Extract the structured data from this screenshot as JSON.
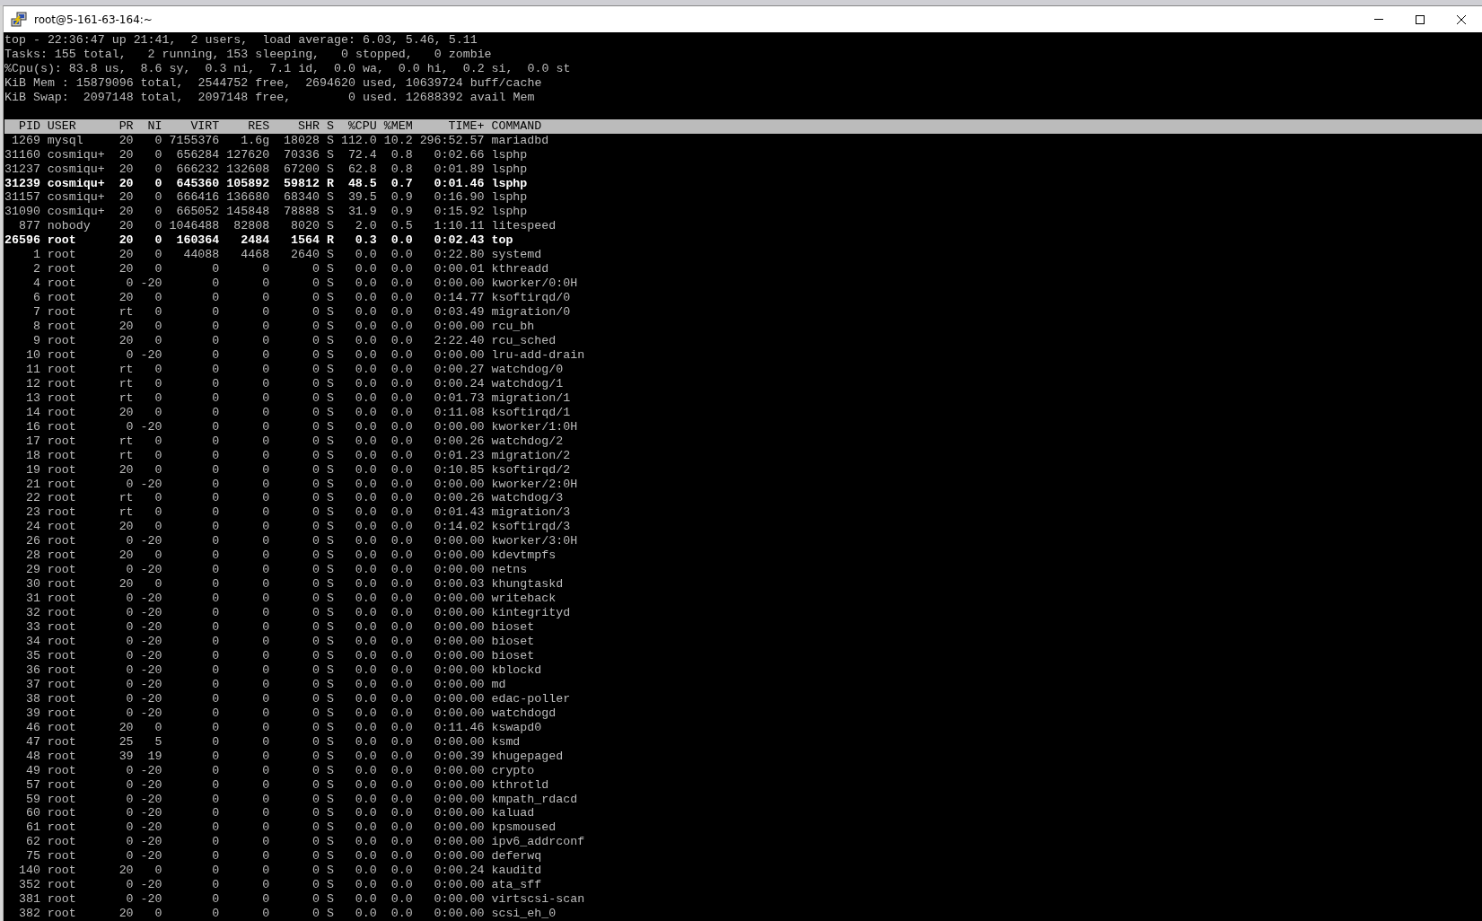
{
  "window": {
    "title": "root@5-161-63-164:~"
  },
  "summary": [
    "top - 22:36:47 up 21:41,  2 users,  load average: 6.03, 5.46, 5.11",
    "Tasks: 155 total,   2 running, 153 sleeping,   0 stopped,   0 zombie",
    "%Cpu(s): 83.8 us,  8.6 sy,  0.3 ni,  7.1 id,  0.0 wa,  0.0 hi,  0.2 si,  0.0 st",
    "KiB Mem : 15879096 total,  2544752 free,  2694620 used, 10639724 buff/cache",
    "KiB Swap:  2097148 total,  2097148 free,        0 used. 12688392 avail Mem"
  ],
  "table": {
    "columns": [
      "PID",
      "USER",
      "PR",
      "NI",
      "VIRT",
      "RES",
      "SHR",
      "S",
      "%CPU",
      "%MEM",
      "TIME+",
      "COMMAND"
    ],
    "rows": [
      {
        "bold": false,
        "cells": [
          "1269",
          "mysql",
          "20",
          "0",
          "7155376",
          "1.6g",
          "18028",
          "S",
          "112.0",
          "10.2",
          "296:52.57",
          "mariadbd"
        ]
      },
      {
        "bold": false,
        "cells": [
          "31160",
          "cosmiqu+",
          "20",
          "0",
          "656284",
          "127620",
          "70336",
          "S",
          "72.4",
          "0.8",
          "0:02.66",
          "lsphp"
        ]
      },
      {
        "bold": false,
        "cells": [
          "31237",
          "cosmiqu+",
          "20",
          "0",
          "666232",
          "132608",
          "67200",
          "S",
          "62.8",
          "0.8",
          "0:01.89",
          "lsphp"
        ]
      },
      {
        "bold": true,
        "cells": [
          "31239",
          "cosmiqu+",
          "20",
          "0",
          "645360",
          "105892",
          "59812",
          "R",
          "48.5",
          "0.7",
          "0:01.46",
          "lsphp"
        ]
      },
      {
        "bold": false,
        "cells": [
          "31157",
          "cosmiqu+",
          "20",
          "0",
          "666416",
          "136680",
          "68340",
          "S",
          "39.5",
          "0.9",
          "0:16.90",
          "lsphp"
        ]
      },
      {
        "bold": false,
        "cells": [
          "31090",
          "cosmiqu+",
          "20",
          "0",
          "665052",
          "145848",
          "78888",
          "S",
          "31.9",
          "0.9",
          "0:15.92",
          "lsphp"
        ]
      },
      {
        "bold": false,
        "cells": [
          "877",
          "nobody",
          "20",
          "0",
          "1046488",
          "82808",
          "8020",
          "S",
          "2.0",
          "0.5",
          "1:10.11",
          "litespeed"
        ]
      },
      {
        "bold": true,
        "cells": [
          "26596",
          "root",
          "20",
          "0",
          "160364",
          "2484",
          "1564",
          "R",
          "0.3",
          "0.0",
          "0:02.43",
          "top"
        ]
      },
      {
        "bold": false,
        "cells": [
          "1",
          "root",
          "20",
          "0",
          "44088",
          "4468",
          "2640",
          "S",
          "0.0",
          "0.0",
          "0:22.80",
          "systemd"
        ]
      },
      {
        "bold": false,
        "cells": [
          "2",
          "root",
          "20",
          "0",
          "0",
          "0",
          "0",
          "S",
          "0.0",
          "0.0",
          "0:00.01",
          "kthreadd"
        ]
      },
      {
        "bold": false,
        "cells": [
          "4",
          "root",
          "0",
          "-20",
          "0",
          "0",
          "0",
          "S",
          "0.0",
          "0.0",
          "0:00.00",
          "kworker/0:0H"
        ]
      },
      {
        "bold": false,
        "cells": [
          "6",
          "root",
          "20",
          "0",
          "0",
          "0",
          "0",
          "S",
          "0.0",
          "0.0",
          "0:14.77",
          "ksoftirqd/0"
        ]
      },
      {
        "bold": false,
        "cells": [
          "7",
          "root",
          "rt",
          "0",
          "0",
          "0",
          "0",
          "S",
          "0.0",
          "0.0",
          "0:03.49",
          "migration/0"
        ]
      },
      {
        "bold": false,
        "cells": [
          "8",
          "root",
          "20",
          "0",
          "0",
          "0",
          "0",
          "S",
          "0.0",
          "0.0",
          "0:00.00",
          "rcu_bh"
        ]
      },
      {
        "bold": false,
        "cells": [
          "9",
          "root",
          "20",
          "0",
          "0",
          "0",
          "0",
          "S",
          "0.0",
          "0.0",
          "2:22.40",
          "rcu_sched"
        ]
      },
      {
        "bold": false,
        "cells": [
          "10",
          "root",
          "0",
          "-20",
          "0",
          "0",
          "0",
          "S",
          "0.0",
          "0.0",
          "0:00.00",
          "lru-add-drain"
        ]
      },
      {
        "bold": false,
        "cells": [
          "11",
          "root",
          "rt",
          "0",
          "0",
          "0",
          "0",
          "S",
          "0.0",
          "0.0",
          "0:00.27",
          "watchdog/0"
        ]
      },
      {
        "bold": false,
        "cells": [
          "12",
          "root",
          "rt",
          "0",
          "0",
          "0",
          "0",
          "S",
          "0.0",
          "0.0",
          "0:00.24",
          "watchdog/1"
        ]
      },
      {
        "bold": false,
        "cells": [
          "13",
          "root",
          "rt",
          "0",
          "0",
          "0",
          "0",
          "S",
          "0.0",
          "0.0",
          "0:01.73",
          "migration/1"
        ]
      },
      {
        "bold": false,
        "cells": [
          "14",
          "root",
          "20",
          "0",
          "0",
          "0",
          "0",
          "S",
          "0.0",
          "0.0",
          "0:11.08",
          "ksoftirqd/1"
        ]
      },
      {
        "bold": false,
        "cells": [
          "16",
          "root",
          "0",
          "-20",
          "0",
          "0",
          "0",
          "S",
          "0.0",
          "0.0",
          "0:00.00",
          "kworker/1:0H"
        ]
      },
      {
        "bold": false,
        "cells": [
          "17",
          "root",
          "rt",
          "0",
          "0",
          "0",
          "0",
          "S",
          "0.0",
          "0.0",
          "0:00.26",
          "watchdog/2"
        ]
      },
      {
        "bold": false,
        "cells": [
          "18",
          "root",
          "rt",
          "0",
          "0",
          "0",
          "0",
          "S",
          "0.0",
          "0.0",
          "0:01.23",
          "migration/2"
        ]
      },
      {
        "bold": false,
        "cells": [
          "19",
          "root",
          "20",
          "0",
          "0",
          "0",
          "0",
          "S",
          "0.0",
          "0.0",
          "0:10.85",
          "ksoftirqd/2"
        ]
      },
      {
        "bold": false,
        "cells": [
          "21",
          "root",
          "0",
          "-20",
          "0",
          "0",
          "0",
          "S",
          "0.0",
          "0.0",
          "0:00.00",
          "kworker/2:0H"
        ]
      },
      {
        "bold": false,
        "cells": [
          "22",
          "root",
          "rt",
          "0",
          "0",
          "0",
          "0",
          "S",
          "0.0",
          "0.0",
          "0:00.26",
          "watchdog/3"
        ]
      },
      {
        "bold": false,
        "cells": [
          "23",
          "root",
          "rt",
          "0",
          "0",
          "0",
          "0",
          "S",
          "0.0",
          "0.0",
          "0:01.43",
          "migration/3"
        ]
      },
      {
        "bold": false,
        "cells": [
          "24",
          "root",
          "20",
          "0",
          "0",
          "0",
          "0",
          "S",
          "0.0",
          "0.0",
          "0:14.02",
          "ksoftirqd/3"
        ]
      },
      {
        "bold": false,
        "cells": [
          "26",
          "root",
          "0",
          "-20",
          "0",
          "0",
          "0",
          "S",
          "0.0",
          "0.0",
          "0:00.00",
          "kworker/3:0H"
        ]
      },
      {
        "bold": false,
        "cells": [
          "28",
          "root",
          "20",
          "0",
          "0",
          "0",
          "0",
          "S",
          "0.0",
          "0.0",
          "0:00.00",
          "kdevtmpfs"
        ]
      },
      {
        "bold": false,
        "cells": [
          "29",
          "root",
          "0",
          "-20",
          "0",
          "0",
          "0",
          "S",
          "0.0",
          "0.0",
          "0:00.00",
          "netns"
        ]
      },
      {
        "bold": false,
        "cells": [
          "30",
          "root",
          "20",
          "0",
          "0",
          "0",
          "0",
          "S",
          "0.0",
          "0.0",
          "0:00.03",
          "khungtaskd"
        ]
      },
      {
        "bold": false,
        "cells": [
          "31",
          "root",
          "0",
          "-20",
          "0",
          "0",
          "0",
          "S",
          "0.0",
          "0.0",
          "0:00.00",
          "writeback"
        ]
      },
      {
        "bold": false,
        "cells": [
          "32",
          "root",
          "0",
          "-20",
          "0",
          "0",
          "0",
          "S",
          "0.0",
          "0.0",
          "0:00.00",
          "kintegrityd"
        ]
      },
      {
        "bold": false,
        "cells": [
          "33",
          "root",
          "0",
          "-20",
          "0",
          "0",
          "0",
          "S",
          "0.0",
          "0.0",
          "0:00.00",
          "bioset"
        ]
      },
      {
        "bold": false,
        "cells": [
          "34",
          "root",
          "0",
          "-20",
          "0",
          "0",
          "0",
          "S",
          "0.0",
          "0.0",
          "0:00.00",
          "bioset"
        ]
      },
      {
        "bold": false,
        "cells": [
          "35",
          "root",
          "0",
          "-20",
          "0",
          "0",
          "0",
          "S",
          "0.0",
          "0.0",
          "0:00.00",
          "bioset"
        ]
      },
      {
        "bold": false,
        "cells": [
          "36",
          "root",
          "0",
          "-20",
          "0",
          "0",
          "0",
          "S",
          "0.0",
          "0.0",
          "0:00.00",
          "kblockd"
        ]
      },
      {
        "bold": false,
        "cells": [
          "37",
          "root",
          "0",
          "-20",
          "0",
          "0",
          "0",
          "S",
          "0.0",
          "0.0",
          "0:00.00",
          "md"
        ]
      },
      {
        "bold": false,
        "cells": [
          "38",
          "root",
          "0",
          "-20",
          "0",
          "0",
          "0",
          "S",
          "0.0",
          "0.0",
          "0:00.00",
          "edac-poller"
        ]
      },
      {
        "bold": false,
        "cells": [
          "39",
          "root",
          "0",
          "-20",
          "0",
          "0",
          "0",
          "S",
          "0.0",
          "0.0",
          "0:00.00",
          "watchdogd"
        ]
      },
      {
        "bold": false,
        "cells": [
          "46",
          "root",
          "20",
          "0",
          "0",
          "0",
          "0",
          "S",
          "0.0",
          "0.0",
          "0:11.46",
          "kswapd0"
        ]
      },
      {
        "bold": false,
        "cells": [
          "47",
          "root",
          "25",
          "5",
          "0",
          "0",
          "0",
          "S",
          "0.0",
          "0.0",
          "0:00.00",
          "ksmd"
        ]
      },
      {
        "bold": false,
        "cells": [
          "48",
          "root",
          "39",
          "19",
          "0",
          "0",
          "0",
          "S",
          "0.0",
          "0.0",
          "0:00.39",
          "khugepaged"
        ]
      },
      {
        "bold": false,
        "cells": [
          "49",
          "root",
          "0",
          "-20",
          "0",
          "0",
          "0",
          "S",
          "0.0",
          "0.0",
          "0:00.00",
          "crypto"
        ]
      },
      {
        "bold": false,
        "cells": [
          "57",
          "root",
          "0",
          "-20",
          "0",
          "0",
          "0",
          "S",
          "0.0",
          "0.0",
          "0:00.00",
          "kthrotld"
        ]
      },
      {
        "bold": false,
        "cells": [
          "59",
          "root",
          "0",
          "-20",
          "0",
          "0",
          "0",
          "S",
          "0.0",
          "0.0",
          "0:00.00",
          "kmpath_rdacd"
        ]
      },
      {
        "bold": false,
        "cells": [
          "60",
          "root",
          "0",
          "-20",
          "0",
          "0",
          "0",
          "S",
          "0.0",
          "0.0",
          "0:00.00",
          "kaluad"
        ]
      },
      {
        "bold": false,
        "cells": [
          "61",
          "root",
          "0",
          "-20",
          "0",
          "0",
          "0",
          "S",
          "0.0",
          "0.0",
          "0:00.00",
          "kpsmoused"
        ]
      },
      {
        "bold": false,
        "cells": [
          "62",
          "root",
          "0",
          "-20",
          "0",
          "0",
          "0",
          "S",
          "0.0",
          "0.0",
          "0:00.00",
          "ipv6_addrconf"
        ]
      },
      {
        "bold": false,
        "cells": [
          "75",
          "root",
          "0",
          "-20",
          "0",
          "0",
          "0",
          "S",
          "0.0",
          "0.0",
          "0:00.00",
          "deferwq"
        ]
      },
      {
        "bold": false,
        "cells": [
          "140",
          "root",
          "20",
          "0",
          "0",
          "0",
          "0",
          "S",
          "0.0",
          "0.0",
          "0:00.24",
          "kauditd"
        ]
      },
      {
        "bold": false,
        "cells": [
          "352",
          "root",
          "0",
          "-20",
          "0",
          "0",
          "0",
          "S",
          "0.0",
          "0.0",
          "0:00.00",
          "ata_sff"
        ]
      },
      {
        "bold": false,
        "cells": [
          "381",
          "root",
          "0",
          "-20",
          "0",
          "0",
          "0",
          "S",
          "0.0",
          "0.0",
          "0:00.00",
          "virtscsi-scan"
        ]
      },
      {
        "bold": false,
        "cells": [
          "382",
          "root",
          "20",
          "0",
          "0",
          "0",
          "0",
          "S",
          "0.0",
          "0.0",
          "0:00.00",
          "scsi_eh_0"
        ]
      }
    ]
  }
}
